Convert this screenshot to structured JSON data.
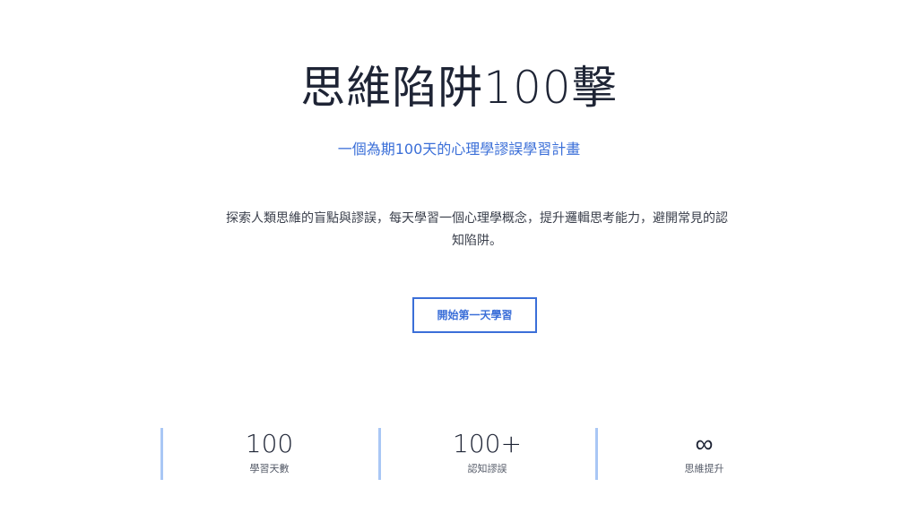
{
  "hero": {
    "title": "思維陷阱100擊",
    "subtitle": "一個為期100天的心理學謬誤學習計畫",
    "description": "探索人類思維的盲點與謬誤，每天學習一個心理學概念，提升邏輯思考能力，避開常見的認知陷阱。",
    "cta_label": "開始第一天學習"
  },
  "stats": [
    {
      "value": "100",
      "label": "學習天數"
    },
    {
      "value": "100+",
      "label": "認知謬誤"
    },
    {
      "value": "∞",
      "label": "思維提升"
    }
  ],
  "colors": {
    "accent": "#3b6fd8",
    "stat_border": "#a9c7f5",
    "title": "#1e2435"
  }
}
